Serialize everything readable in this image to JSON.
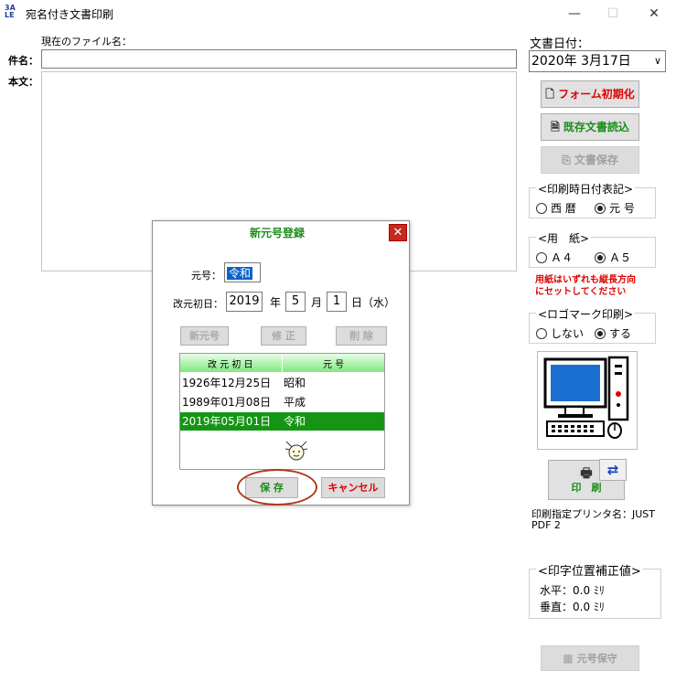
{
  "window": {
    "title": "宛名付き文書印刷",
    "app_icon_text": "3A LE",
    "minimize": "—",
    "maximize": "☐",
    "close": "✕"
  },
  "main": {
    "current_file_label": "現在のファイル名：",
    "subject_label": "件名：",
    "subject_value": "",
    "body_label": "本文：",
    "body_value": ""
  },
  "right": {
    "doc_date_label": "文書日付：",
    "doc_date_value": "2020年  3月17日",
    "form_init": "フォーム初期化",
    "load_doc": "既存文書読込",
    "save_doc": "文書保存",
    "print_date_group": "<印刷時日付表記>",
    "seireki": "西 暦",
    "gengo": "元 号",
    "date_format_selected": "元 号",
    "paper_group": "<用　紙>",
    "a4": "Ａ４",
    "a5": "Ａ５",
    "paper_selected": "Ａ５",
    "paper_note_1": "用紙はいずれも縦長方向",
    "paper_note_2": "にセットしてください",
    "logo_group": "<ロゴマーク印刷>",
    "logo_no": "しない",
    "logo_yes": "する",
    "logo_selected": "する",
    "print_btn": "印　刷",
    "printer_label_1": "印刷指定プリンタ名：JUST",
    "printer_label_2": "PDF 2",
    "offset_group": "<印字位置補正値>",
    "horizontal": "水平：0.0 ﾐﾘ",
    "vertical": "垂直：0.0 ﾐﾘ",
    "save_gengo": "元号保守"
  },
  "dialog": {
    "title": "新元号登録",
    "gengo_label": "元号：",
    "gengo_value": "令和",
    "start_label": "改元初日：",
    "year": "2019",
    "year_unit": "年",
    "month": "5",
    "month_unit": "月",
    "day": "1",
    "day_unit": "日",
    "weekday": "（水）",
    "new_btn": "新元号",
    "edit_btn": "修 正",
    "delete_btn": "削 除",
    "col1": "改 元 初 日",
    "col2": "元 号",
    "rows": [
      {
        "date": "1926年12月25日",
        "era": "昭和"
      },
      {
        "date": "1989年01月08日",
        "era": "平成"
      },
      {
        "date": "2019年05月01日",
        "era": "令和"
      }
    ],
    "selected_row": 2,
    "save_btn": "保 存",
    "cancel_btn": "キャンセル"
  }
}
